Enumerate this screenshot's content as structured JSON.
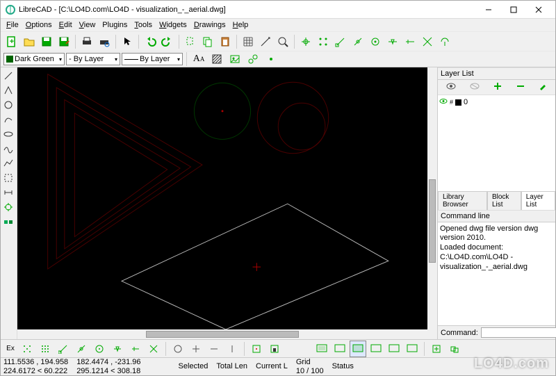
{
  "title": "LibreCAD - [C:\\LO4D.com\\LO4D - visualization_-_aerial.dwg]",
  "menus": {
    "file": "File",
    "options": "Options",
    "edit": "Edit",
    "view": "View",
    "plugins": "Plugins",
    "tools": "Tools",
    "widgets": "Widgets",
    "drawings": "Drawings",
    "help": "Help"
  },
  "toolbar": {
    "color_selector": "Dark Green",
    "width_selector": "- By Layer",
    "linetype_selector": "By Layer"
  },
  "panels": {
    "layer_list_title": "Layer List",
    "layer_name": "0",
    "tabs": {
      "library": "Library Browser",
      "block": "Block List",
      "layer": "Layer List"
    },
    "command_line_title": "Command line",
    "command_output_1": "Opened dwg file version dwg version 2010.",
    "command_output_2": "Loaded document: C:\\LO4D.com\\LO4D - visualization_-_aerial.dwg",
    "command_label": "Command:"
  },
  "status": {
    "ex_btn": "Ex",
    "coords_row1_a": "111.5536 , 194.958",
    "coords_row1_b": "182.4474 , -231.96",
    "coords_row2_a": "224.6172 < 60.222",
    "coords_row2_b": "295.1214 < 308.18",
    "selected_label": "Selected",
    "total_label": "Total Len",
    "current_label": "Current L",
    "grid_label": "Grid",
    "grid_value": "10 / 100",
    "status_label": "Status"
  },
  "chart_data": {
    "type": "cad-drawing",
    "background": "#000000",
    "entities": [
      {
        "type": "triangle-outline",
        "color": "#5a0000",
        "count": 4,
        "nested": true,
        "approx_region": "upper-left"
      },
      {
        "type": "circle",
        "color": "#003300",
        "count": 1,
        "approx_region": "top-center",
        "has_center_point": true
      },
      {
        "type": "circle",
        "color": "#5a0000",
        "count": 2,
        "nested": true,
        "approx_region": "top-right-center"
      },
      {
        "type": "quadrilateral",
        "color": "#cccccc",
        "count": 1,
        "approx_region": "lower-center",
        "has_center_cross": true,
        "cross_color": "#aa0000"
      }
    ]
  },
  "watermark": "LO4D.com"
}
